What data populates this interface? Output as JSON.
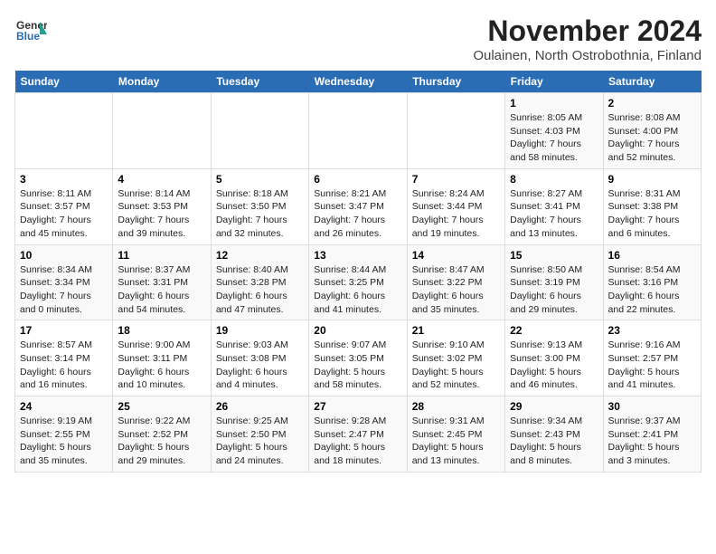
{
  "header": {
    "logo_general": "General",
    "logo_blue": "Blue",
    "title": "November 2024",
    "subtitle": "Oulainen, North Ostrobothnia, Finland"
  },
  "weekdays": [
    "Sunday",
    "Monday",
    "Tuesday",
    "Wednesday",
    "Thursday",
    "Friday",
    "Saturday"
  ],
  "weeks": [
    [
      {
        "day": "",
        "info": ""
      },
      {
        "day": "",
        "info": ""
      },
      {
        "day": "",
        "info": ""
      },
      {
        "day": "",
        "info": ""
      },
      {
        "day": "",
        "info": ""
      },
      {
        "day": "1",
        "info": "Sunrise: 8:05 AM\nSunset: 4:03 PM\nDaylight: 7 hours\nand 58 minutes."
      },
      {
        "day": "2",
        "info": "Sunrise: 8:08 AM\nSunset: 4:00 PM\nDaylight: 7 hours\nand 52 minutes."
      }
    ],
    [
      {
        "day": "3",
        "info": "Sunrise: 8:11 AM\nSunset: 3:57 PM\nDaylight: 7 hours\nand 45 minutes."
      },
      {
        "day": "4",
        "info": "Sunrise: 8:14 AM\nSunset: 3:53 PM\nDaylight: 7 hours\nand 39 minutes."
      },
      {
        "day": "5",
        "info": "Sunrise: 8:18 AM\nSunset: 3:50 PM\nDaylight: 7 hours\nand 32 minutes."
      },
      {
        "day": "6",
        "info": "Sunrise: 8:21 AM\nSunset: 3:47 PM\nDaylight: 7 hours\nand 26 minutes."
      },
      {
        "day": "7",
        "info": "Sunrise: 8:24 AM\nSunset: 3:44 PM\nDaylight: 7 hours\nand 19 minutes."
      },
      {
        "day": "8",
        "info": "Sunrise: 8:27 AM\nSunset: 3:41 PM\nDaylight: 7 hours\nand 13 minutes."
      },
      {
        "day": "9",
        "info": "Sunrise: 8:31 AM\nSunset: 3:38 PM\nDaylight: 7 hours\nand 6 minutes."
      }
    ],
    [
      {
        "day": "10",
        "info": "Sunrise: 8:34 AM\nSunset: 3:34 PM\nDaylight: 7 hours\nand 0 minutes."
      },
      {
        "day": "11",
        "info": "Sunrise: 8:37 AM\nSunset: 3:31 PM\nDaylight: 6 hours\nand 54 minutes."
      },
      {
        "day": "12",
        "info": "Sunrise: 8:40 AM\nSunset: 3:28 PM\nDaylight: 6 hours\nand 47 minutes."
      },
      {
        "day": "13",
        "info": "Sunrise: 8:44 AM\nSunset: 3:25 PM\nDaylight: 6 hours\nand 41 minutes."
      },
      {
        "day": "14",
        "info": "Sunrise: 8:47 AM\nSunset: 3:22 PM\nDaylight: 6 hours\nand 35 minutes."
      },
      {
        "day": "15",
        "info": "Sunrise: 8:50 AM\nSunset: 3:19 PM\nDaylight: 6 hours\nand 29 minutes."
      },
      {
        "day": "16",
        "info": "Sunrise: 8:54 AM\nSunset: 3:16 PM\nDaylight: 6 hours\nand 22 minutes."
      }
    ],
    [
      {
        "day": "17",
        "info": "Sunrise: 8:57 AM\nSunset: 3:14 PM\nDaylight: 6 hours\nand 16 minutes."
      },
      {
        "day": "18",
        "info": "Sunrise: 9:00 AM\nSunset: 3:11 PM\nDaylight: 6 hours\nand 10 minutes."
      },
      {
        "day": "19",
        "info": "Sunrise: 9:03 AM\nSunset: 3:08 PM\nDaylight: 6 hours\nand 4 minutes."
      },
      {
        "day": "20",
        "info": "Sunrise: 9:07 AM\nSunset: 3:05 PM\nDaylight: 5 hours\nand 58 minutes."
      },
      {
        "day": "21",
        "info": "Sunrise: 9:10 AM\nSunset: 3:02 PM\nDaylight: 5 hours\nand 52 minutes."
      },
      {
        "day": "22",
        "info": "Sunrise: 9:13 AM\nSunset: 3:00 PM\nDaylight: 5 hours\nand 46 minutes."
      },
      {
        "day": "23",
        "info": "Sunrise: 9:16 AM\nSunset: 2:57 PM\nDaylight: 5 hours\nand 41 minutes."
      }
    ],
    [
      {
        "day": "24",
        "info": "Sunrise: 9:19 AM\nSunset: 2:55 PM\nDaylight: 5 hours\nand 35 minutes."
      },
      {
        "day": "25",
        "info": "Sunrise: 9:22 AM\nSunset: 2:52 PM\nDaylight: 5 hours\nand 29 minutes."
      },
      {
        "day": "26",
        "info": "Sunrise: 9:25 AM\nSunset: 2:50 PM\nDaylight: 5 hours\nand 24 minutes."
      },
      {
        "day": "27",
        "info": "Sunrise: 9:28 AM\nSunset: 2:47 PM\nDaylight: 5 hours\nand 18 minutes."
      },
      {
        "day": "28",
        "info": "Sunrise: 9:31 AM\nSunset: 2:45 PM\nDaylight: 5 hours\nand 13 minutes."
      },
      {
        "day": "29",
        "info": "Sunrise: 9:34 AM\nSunset: 2:43 PM\nDaylight: 5 hours\nand 8 minutes."
      },
      {
        "day": "30",
        "info": "Sunrise: 9:37 AM\nSunset: 2:41 PM\nDaylight: 5 hours\nand 3 minutes."
      }
    ]
  ]
}
